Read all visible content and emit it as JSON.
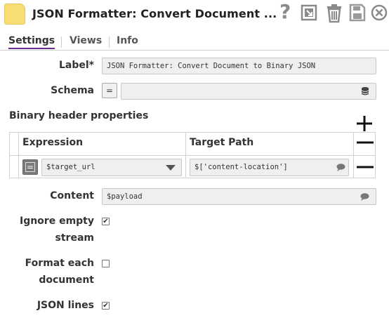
{
  "header": {
    "title": "JSON Formatter: Convert Document ...",
    "icons": [
      "document-icon",
      "help-icon",
      "export-icon",
      "delete-icon",
      "save-icon",
      "close-icon"
    ]
  },
  "tabs": [
    {
      "label": "Settings",
      "active": true
    },
    {
      "label": "Views",
      "active": false
    },
    {
      "label": "Info",
      "active": false
    }
  ],
  "form": {
    "label_label": "Label*",
    "label_value": "JSON Formatter: Convert Document to Binary JSON",
    "schema_label": "Schema",
    "schema_value": "",
    "expression_toggle": "=",
    "binary_header_heading": "Binary header properties",
    "table": {
      "col_expression": "Expression",
      "col_target": "Target Path",
      "rows": [
        {
          "expression": "$target_url",
          "target_path": "$['content-location']"
        }
      ]
    },
    "content_label": "Content",
    "content_value": "$payload",
    "ignore_empty_label_1": "Ignore empty",
    "ignore_empty_label_2": "stream",
    "ignore_empty_checked": true,
    "format_each_label_1": "Format each",
    "format_each_label_2": "document",
    "format_each_checked": false,
    "json_lines_label": "JSON lines",
    "json_lines_checked": true,
    "check_mark": "✔"
  },
  "colors": {
    "accent": "#6a2c8f",
    "doc_icon": "#f7dd72",
    "field_bg": "#efefef"
  }
}
